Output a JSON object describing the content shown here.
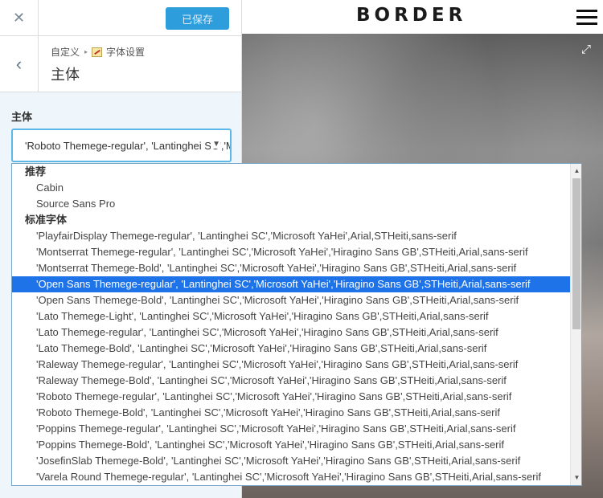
{
  "header": {
    "close_label": "✕",
    "save_label": "已保存"
  },
  "nav": {
    "back_label": "‹",
    "breadcrumb_root": "自定义",
    "breadcrumb_section": "字体设置",
    "panel_title": "主体"
  },
  "field": {
    "label": "主体",
    "selected_value": "'Roboto Themege-regular', 'Lantinghei SC','Microsoft YaHei'"
  },
  "preview": {
    "brand": "BORDER"
  },
  "dropdown": {
    "groups": [
      {
        "label": "推荐",
        "options": [
          "Cabin",
          "Source Sans Pro"
        ]
      },
      {
        "label": "标准字体",
        "options": [
          "'PlayfairDisplay Themege-regular', 'Lantinghei SC','Microsoft YaHei',Arial,STHeiti,sans-serif",
          "'Montserrat Themege-regular', 'Lantinghei SC','Microsoft YaHei','Hiragino Sans GB',STHeiti,Arial,sans-serif",
          "'Montserrat Themege-Bold', 'Lantinghei SC','Microsoft YaHei','Hiragino Sans GB',STHeiti,Arial,sans-serif",
          "'Open Sans Themege-regular', 'Lantinghei SC','Microsoft YaHei','Hiragino Sans GB',STHeiti,Arial,sans-serif",
          "'Open Sans Themege-Bold', 'Lantinghei SC','Microsoft YaHei','Hiragino Sans GB',STHeiti,Arial,sans-serif",
          "'Lato Themege-Light', 'Lantinghei SC','Microsoft YaHei','Hiragino Sans GB',STHeiti,Arial,sans-serif",
          "'Lato Themege-regular', 'Lantinghei SC','Microsoft YaHei','Hiragino Sans GB',STHeiti,Arial,sans-serif",
          "'Lato Themege-Bold', 'Lantinghei SC','Microsoft YaHei','Hiragino Sans GB',STHeiti,Arial,sans-serif",
          "'Raleway Themege-regular', 'Lantinghei SC','Microsoft YaHei','Hiragino Sans GB',STHeiti,Arial,sans-serif",
          "'Raleway Themege-Bold', 'Lantinghei SC','Microsoft YaHei','Hiragino Sans GB',STHeiti,Arial,sans-serif",
          "'Roboto Themege-regular', 'Lantinghei SC','Microsoft YaHei','Hiragino Sans GB',STHeiti,Arial,sans-serif",
          "'Roboto Themege-Bold', 'Lantinghei SC','Microsoft YaHei','Hiragino Sans GB',STHeiti,Arial,sans-serif",
          "'Poppins Themege-regular', 'Lantinghei SC','Microsoft YaHei','Hiragino Sans GB',STHeiti,Arial,sans-serif",
          "'Poppins Themege-Bold', 'Lantinghei SC','Microsoft YaHei','Hiragino Sans GB',STHeiti,Arial,sans-serif",
          "'JosefinSlab Themege-Bold', 'Lantinghei SC','Microsoft YaHei','Hiragino Sans GB',STHeiti,Arial,sans-serif",
          "'Varela Round Themege-regular', 'Lantinghei SC','Microsoft YaHei','Hiragino Sans GB',STHeiti,Arial,sans-serif"
        ]
      }
    ],
    "highlighted": "'Open Sans Themege-regular', 'Lantinghei SC','Microsoft YaHei','Hiragino Sans GB',STHeiti,Arial,sans-serif"
  },
  "colors": {
    "accent": "#2d9ddc",
    "selection": "#1e73e8",
    "sidebar_bg": "#eef6fb"
  }
}
